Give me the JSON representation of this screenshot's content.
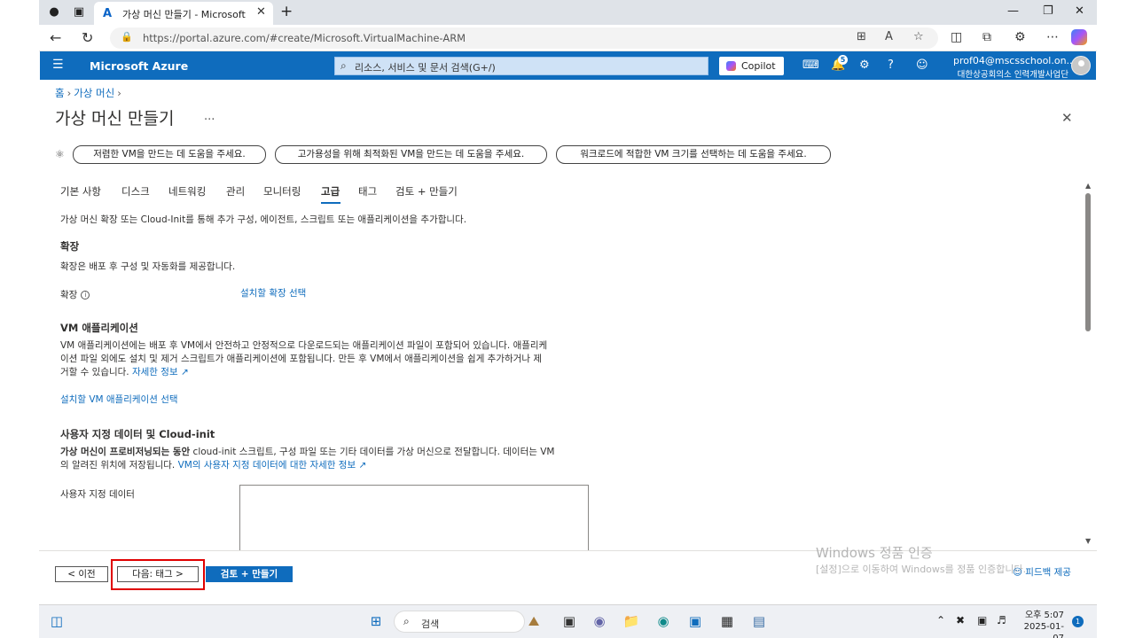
{
  "browser": {
    "tab_title": "가상 머신 만들기 - Microsoft Azure",
    "url": "https://portal.azure.com/#create/Microsoft.VirtualMachine-ARM"
  },
  "azure_header": {
    "brand": "Microsoft Azure",
    "search_placeholder": "리소스, 서비스 및 문서 검색(G+/)",
    "copilot_label": "Copilot",
    "notification_count": "5",
    "account_email": "prof04@mscsschool.on...",
    "account_org": "대한상공회의소 인력개발사업단"
  },
  "breadcrumb": {
    "home": "홈",
    "vm": "가상 머신"
  },
  "page": {
    "title": "가상 머신 만들기",
    "more": "...",
    "suggestions": [
      "저렴한 VM을 만드는 데 도움을 주세요.",
      "고가용성을 위해 최적화된 VM을 만드는 데 도움을 주세요.",
      "워크로드에 적합한 VM 크기를 선택하는 데 도움을 주세요."
    ],
    "tabs": [
      "기본 사항",
      "디스크",
      "네트워킹",
      "관리",
      "모니터링",
      "고급",
      "태그",
      "검토 + 만들기"
    ],
    "selected_tab": "고급",
    "intro": "가상 머신 확장 또는 Cloud-Init를 통해 추가 구성, 에이전트, 스크립트 또는 애플리케이션을 추가합니다."
  },
  "extensions": {
    "heading": "확장",
    "description": "확장은 배포 후 구성 및 자동화를 제공합니다.",
    "field_label": "확장",
    "select_link": "설치할 확장 선택"
  },
  "vm_apps": {
    "heading": "VM 애플리케이션",
    "line1": "VM 애플리케이션에는 배포 후 VM에서 안전하고 안정적으로 다운로드되는 애플리케이션 파일이 포함되어 있습니다. 애플리케",
    "line2": "이션 파일 외에도 설치 및 제거 스크립트가 애플리케이션에 포함됩니다. 만든 후 VM에서 애플리케이션을 쉽게 추가하거나 제",
    "line3": "거할 수 있습니다.",
    "learn_more": "자세한 정보",
    "select_link": "설치할 VM 애플리케이션 선택"
  },
  "custom_data": {
    "heading": "사용자 지정 데이터 및 Cloud-init",
    "bold_prefix": "가상 머신이 프로비저닝되는 동안",
    "line1_rest": " cloud-init 스크립트, 구성 파일 또는 기타 데이터를 가상 머신으로 전달합니다. 데이터는 VM",
    "line2": "의 알려진 위치에 저장됩니다.",
    "learn_more": "VM의 사용자 지정 데이터에 대한 자세한 정보",
    "field_label": "사용자 지정 데이터"
  },
  "footer": {
    "prev": "< 이전",
    "next": "다음: 태그 >",
    "review": "검토 + 만들기",
    "feedback": "피드백 제공",
    "watermark_title": "Windows 정품 인증",
    "watermark_sub": "[설정]으로 이동하여 Windows를 정품 인증합니다."
  },
  "taskbar": {
    "search": "검색",
    "time": "오후 5:07",
    "date": "2025-01-07",
    "notification_count": "1"
  }
}
